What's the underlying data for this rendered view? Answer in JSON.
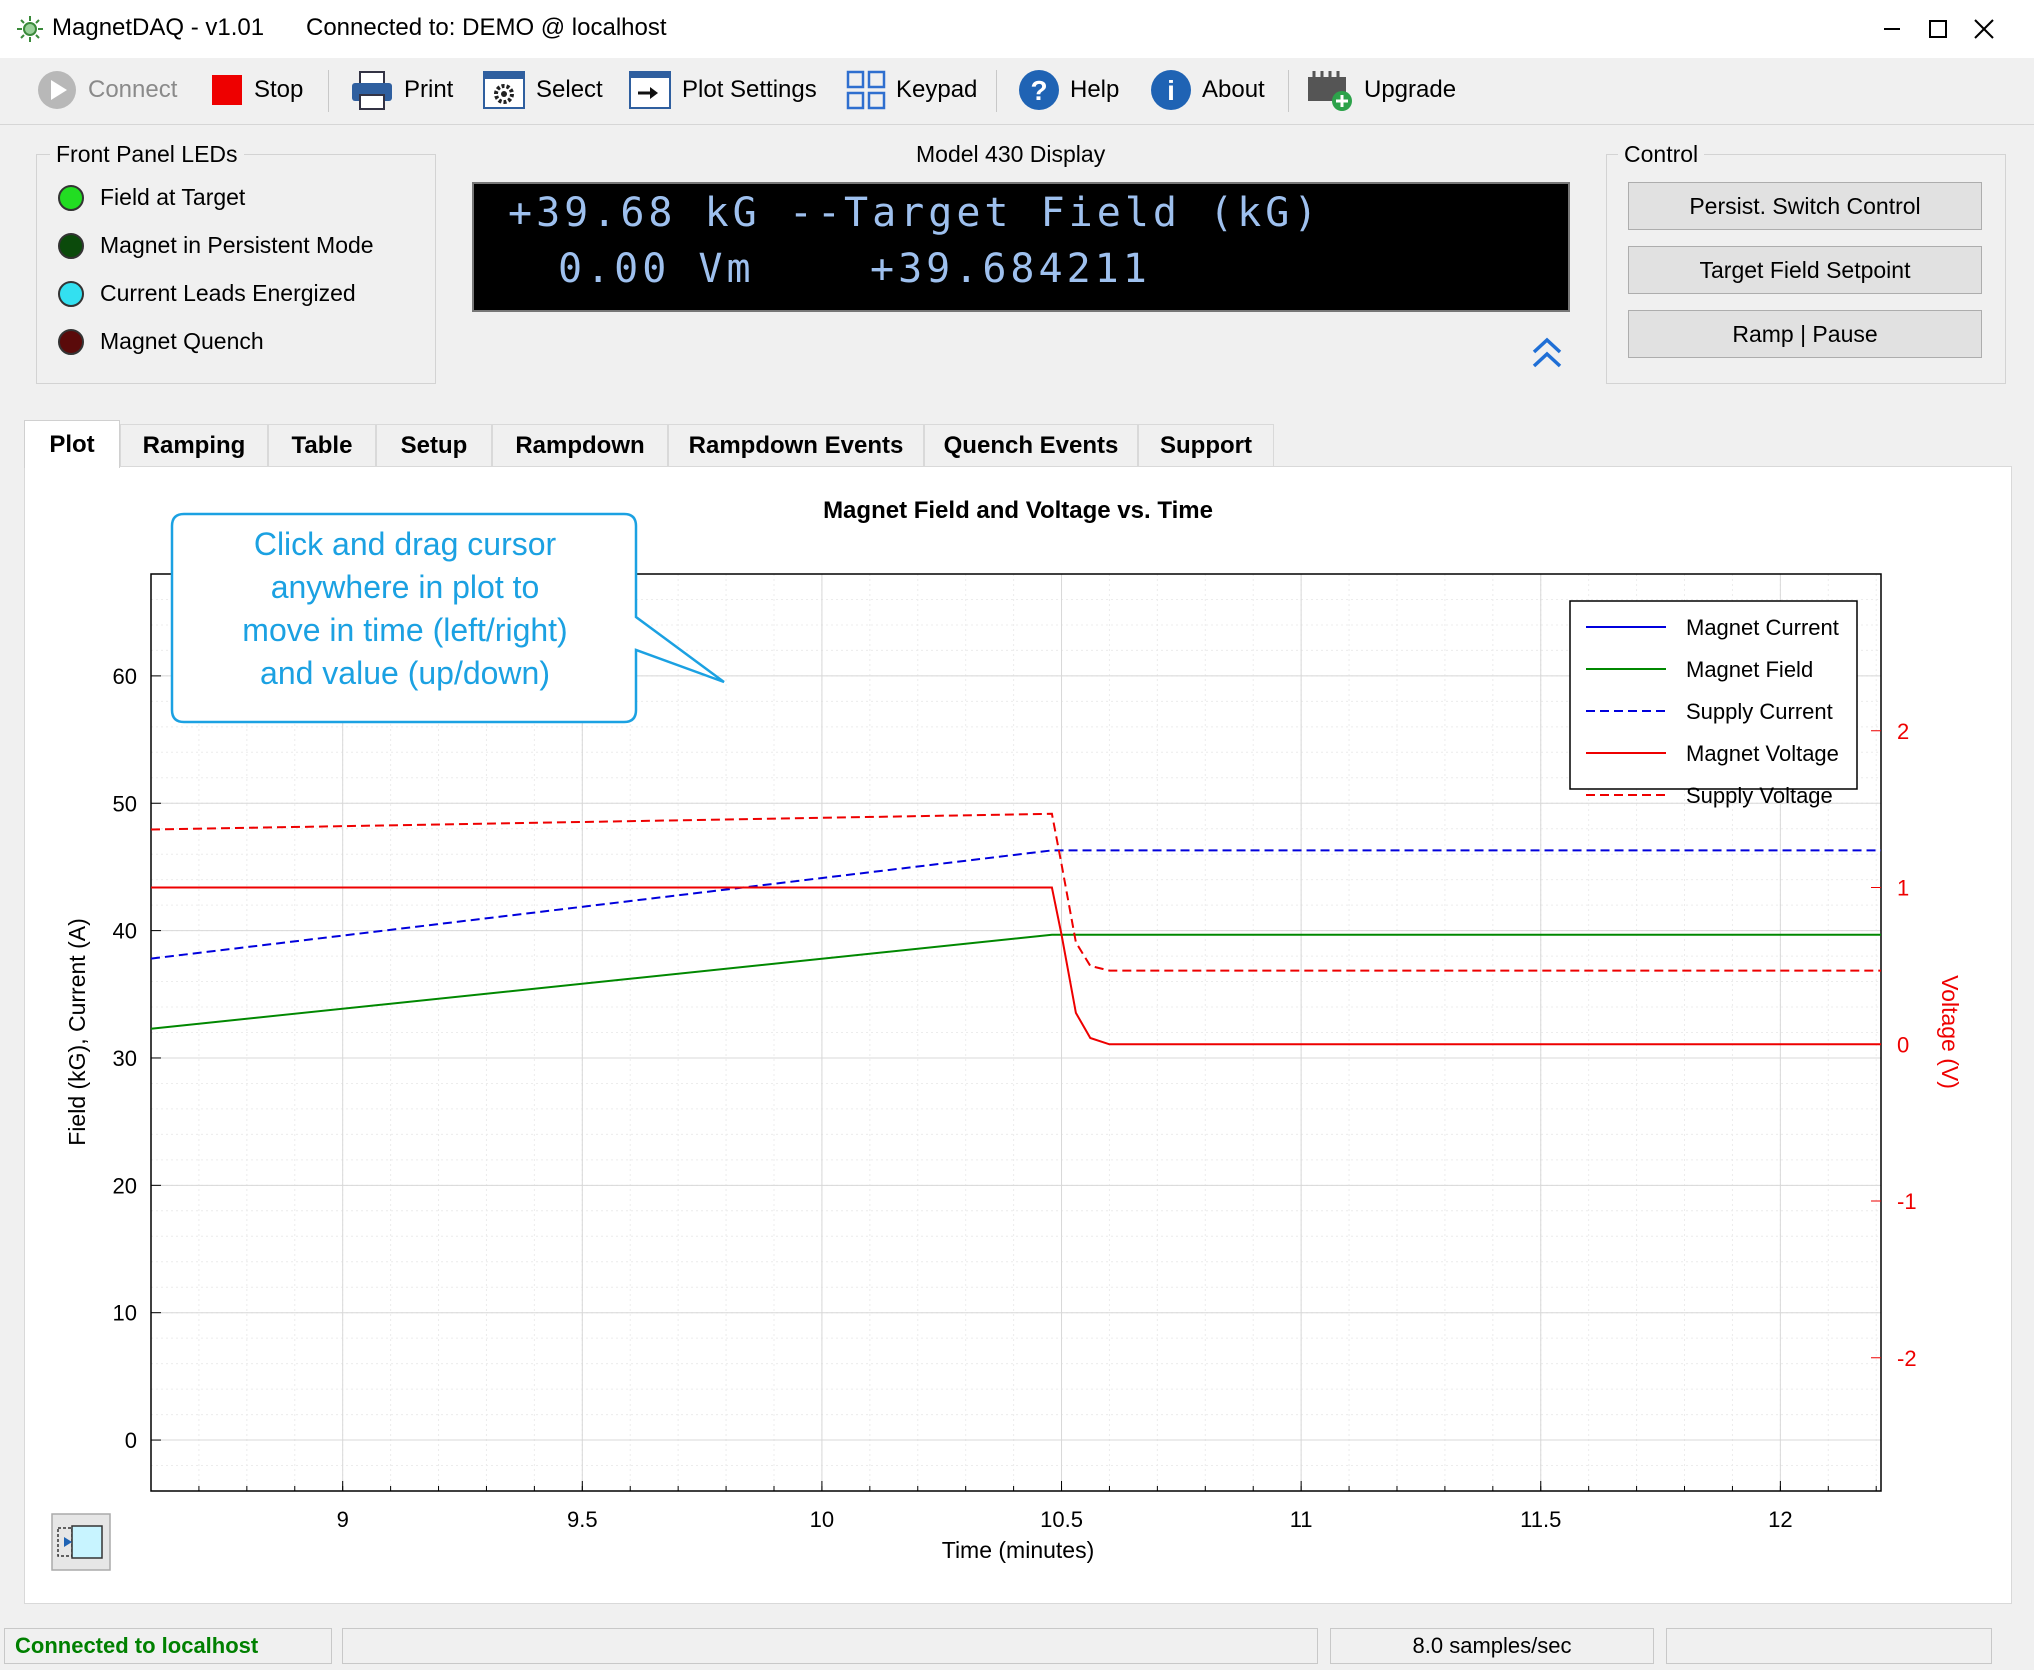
{
  "window": {
    "app_title": "MagnetDAQ - v1.01",
    "connection_title": "Connected to: DEMO @ localhost"
  },
  "toolbar": {
    "connect": "Connect",
    "stop": "Stop",
    "print": "Print",
    "select": "Select",
    "plot_settings": "Plot Settings",
    "keypad": "Keypad",
    "help": "Help",
    "about": "About",
    "upgrade": "Upgrade"
  },
  "front_panel": {
    "title": "Front Panel LEDs",
    "leds": [
      {
        "label": "Field at Target",
        "color": "#22dd22"
      },
      {
        "label": "Magnet in Persistent Mode",
        "color": "#0b4a0b"
      },
      {
        "label": "Current Leads Energized",
        "color": "#33e0f0"
      },
      {
        "label": "Magnet Quench",
        "color": "#5a0a0a"
      }
    ]
  },
  "display": {
    "title": "Model 430 Display",
    "line1_left": "+39.68 kG --",
    "line1_right": "Target Field (kG)",
    "line2_left": "0.00 Vm",
    "line2_right": "+39.684211"
  },
  "control": {
    "title": "Control",
    "buttons": [
      "Persist. Switch Control",
      "Target Field Setpoint",
      "Ramp | Pause"
    ]
  },
  "tabs": [
    "Plot",
    "Ramping",
    "Table",
    "Setup",
    "Rampdown",
    "Rampdown Events",
    "Quench Events",
    "Support"
  ],
  "active_tab": "Plot",
  "callout": {
    "lines": [
      "Click and drag cursor",
      "anywhere in plot to",
      "move in time (left/right)",
      "and value (up/down)"
    ]
  },
  "status_bar": {
    "connection": "Connected to localhost",
    "rate": "8.0 samples/sec"
  },
  "colors": {
    "blue": "#0000dd",
    "green": "#008800",
    "red": "#ee0000",
    "callout_text": "#1ba1e2",
    "status_green": "#008000"
  },
  "chart_data": {
    "type": "line",
    "title": "Magnet Field and Voltage vs. Time",
    "xlabel": "Time (minutes)",
    "ylabel": "Field (kG), Current (A)",
    "y2label": "Voltage (V)",
    "xlim": [
      8.6,
      12.21
    ],
    "ylim": [
      -4,
      68
    ],
    "y2lim": [
      -2.85,
      3.0
    ],
    "xticks": [
      9,
      9.5,
      10,
      10.5,
      11,
      11.5,
      12
    ],
    "yticks": [
      0,
      10,
      20,
      30,
      40,
      50,
      60
    ],
    "y2ticks": [
      -2,
      -1,
      0,
      1,
      2
    ],
    "grid": true,
    "legend_position": "top-right",
    "series": [
      {
        "name": "Magnet Current",
        "axis": "left",
        "color": "#0000dd",
        "dash": false,
        "x": [],
        "y": []
      },
      {
        "name": "Magnet Field",
        "axis": "left",
        "color": "#008800",
        "dash": false,
        "x": [
          8.6,
          10.48,
          12.21
        ],
        "y": [
          32.3,
          39.68,
          39.68
        ]
      },
      {
        "name": "Supply Current",
        "axis": "left",
        "color": "#0000dd",
        "dash": true,
        "x": [
          8.6,
          10.48,
          12.21
        ],
        "y": [
          37.8,
          46.3,
          46.3
        ]
      },
      {
        "name": "Magnet Voltage",
        "axis": "right",
        "color": "#ee0000",
        "dash": false,
        "x": [
          8.6,
          10.48,
          10.5,
          10.53,
          10.56,
          10.6,
          12.21
        ],
        "y": [
          1.0,
          1.0,
          0.7,
          0.2,
          0.04,
          0.0,
          0.0
        ]
      },
      {
        "name": "Supply Voltage",
        "axis": "right",
        "color": "#ee0000",
        "dash": true,
        "x": [
          8.6,
          10.48,
          10.5,
          10.53,
          10.56,
          10.6,
          12.21
        ],
        "y": [
          1.37,
          1.47,
          1.15,
          0.65,
          0.5,
          0.47,
          0.47
        ]
      }
    ]
  }
}
